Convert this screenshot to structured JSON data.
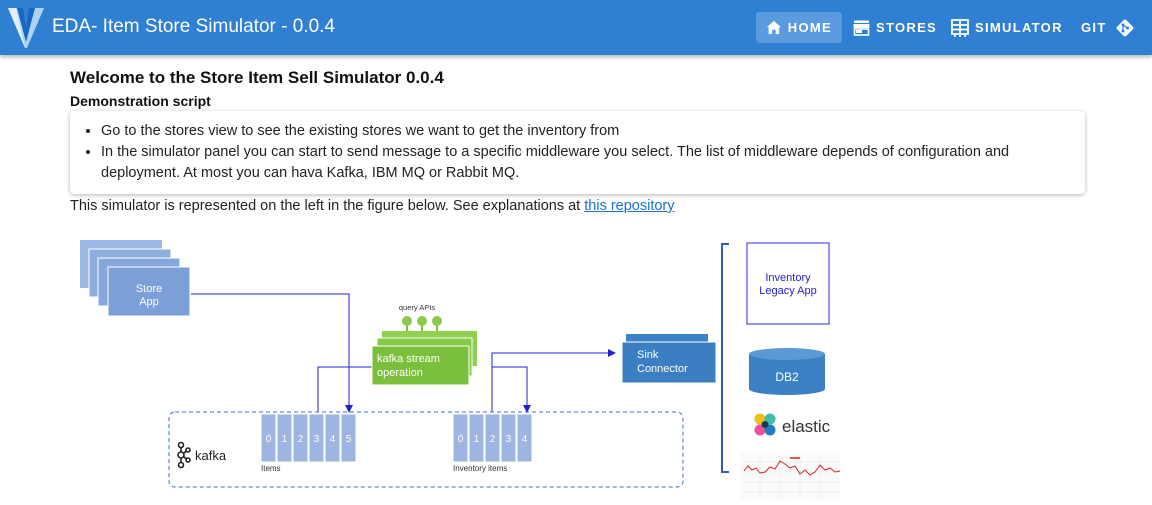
{
  "header": {
    "app_title": "EDA- Item Store Simulator - 0.0.4",
    "nav": [
      {
        "label": "HOME",
        "icon": "home-icon",
        "active": true
      },
      {
        "label": "STORES",
        "icon": "store-icon",
        "active": false
      },
      {
        "label": "SIMULATOR",
        "icon": "view-dashboard-icon",
        "active": false
      },
      {
        "label": "GIT",
        "icon": "git-icon",
        "active": false
      }
    ],
    "colors": {
      "bar": "#2f7fd2",
      "active_tab": "#5a9be0"
    }
  },
  "main": {
    "welcome": "Welcome to the Store Item Sell Simulator 0.0.4",
    "script_heading": "Demonstration script",
    "bullets": [
      "Go to the stores view to see the existing stores we want to get the inventory from",
      "In the simulator panel you can start to send message to a specific middleware you select. The list of middleware depends of configuration and deployment. At most you can hava Kafka, IBM MQ or Rabbit MQ."
    ],
    "explanation_text": "This simulator is represented on the left in the figure below. See explanations at ",
    "repo_link": "this repository"
  },
  "figure": {
    "store_app": [
      "Store",
      "App"
    ],
    "query_apis": "query APIs",
    "kafka_stream": [
      "kafka stream",
      "operation"
    ],
    "sink_connector": [
      "Sink",
      "Connector"
    ],
    "kafka_logo": "kafka",
    "items_label": "Items",
    "items_partitions": [
      "0",
      "1",
      "2",
      "3",
      "4",
      "5"
    ],
    "inventory_label": "Inventory items",
    "inventory_partitions": [
      "0",
      "1",
      "2",
      "3",
      "4"
    ],
    "inventory_legacy": [
      "Inventory",
      "Legacy App"
    ],
    "db2": "DB2",
    "elastic": "elastic"
  }
}
